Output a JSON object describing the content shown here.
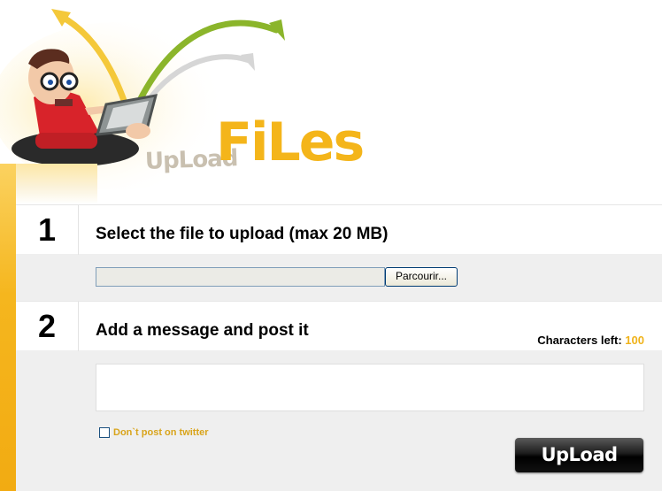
{
  "brand": {
    "upload_word": "UpLoad",
    "files_word": "FiLes"
  },
  "step1": {
    "number": "1",
    "title": "Select the file to upload (max 20 MB)",
    "browse_label": "Parcourir..."
  },
  "step2": {
    "number": "2",
    "title": "Add a message and post it",
    "chars_left_label": "Characters left:",
    "chars_left_value": "100"
  },
  "twitter_option": {
    "label": "Don`t post on twitter",
    "checked": false
  },
  "upload_button": {
    "label": "UpLoad"
  },
  "colors": {
    "accent": "#f4b51a",
    "rail": "#f5b61e",
    "panel": "#efefef",
    "button": "#000000"
  },
  "icons": {
    "mascot": "cartoon-user-with-laptop",
    "arrows": "upload-arrows"
  }
}
